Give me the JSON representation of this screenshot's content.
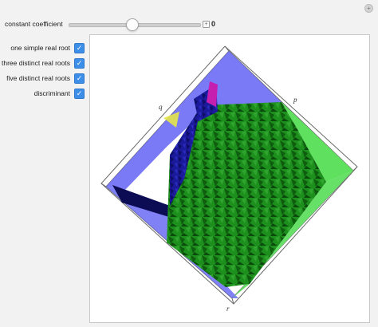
{
  "controls": {
    "slider": {
      "label": "constant coefficient",
      "value": "0",
      "plus_symbol": "+"
    },
    "checkboxes": [
      {
        "label": "one simple real root",
        "checked": true
      },
      {
        "label": "three distinct real roots",
        "checked": true
      },
      {
        "label": "five distinct real roots",
        "checked": true
      },
      {
        "label": "discriminant",
        "checked": true
      }
    ],
    "checkmark": "✓",
    "corner_button": "+"
  },
  "plot": {
    "axis_labels": {
      "q": "q",
      "p": "p",
      "r": "r"
    },
    "colors": {
      "one_simple_real_root": "#6b6bf5",
      "three_distinct_real_roots": "#1d8f1d",
      "five_distinct_real_roots": "#5fe05f",
      "discriminant": "#e6e64a",
      "accent_magenta": "#c51fb0"
    }
  }
}
